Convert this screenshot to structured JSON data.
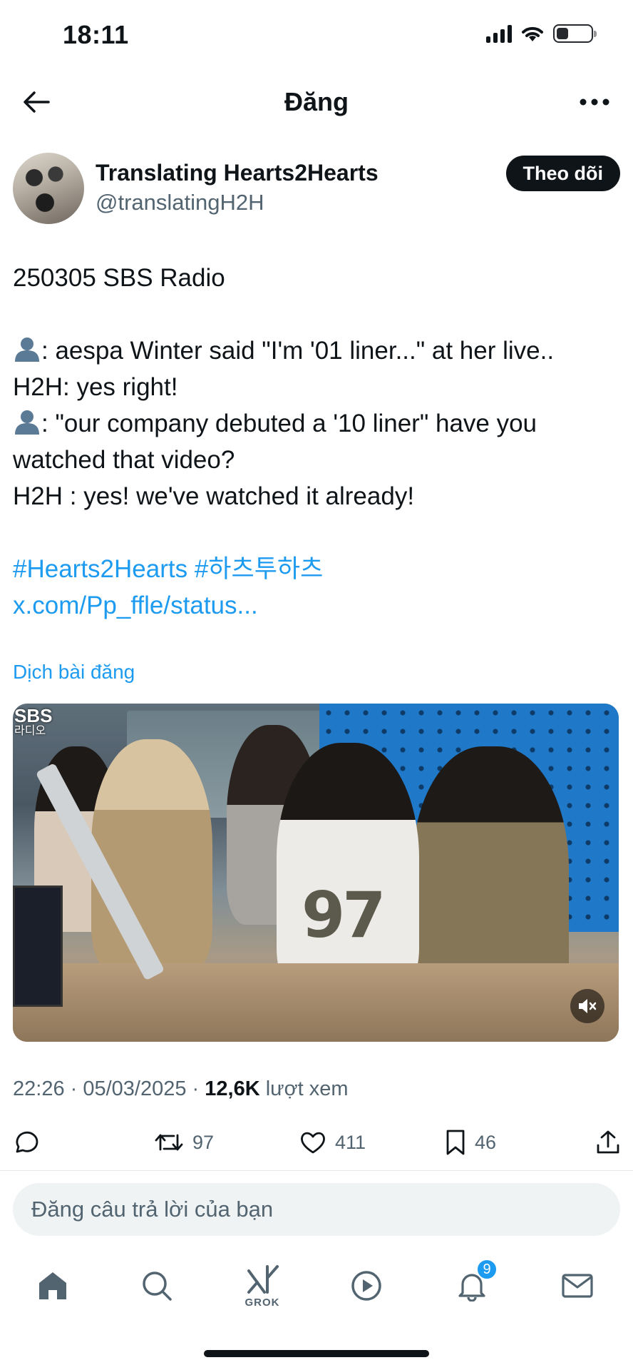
{
  "status_bar": {
    "time": "18:11",
    "battery_level": 0.35
  },
  "header": {
    "title": "Đăng"
  },
  "author": {
    "name": "Translating Hearts2Hearts",
    "handle": "@translatingH2H",
    "follow_label": "Theo dõi"
  },
  "post": {
    "lines": [
      {
        "text": "250305 SBS Radio",
        "icon": ""
      },
      {
        "text": "",
        "icon": ""
      },
      {
        "text": ": aespa Winter said \"I'm '01 liner...\" at her live..",
        "icon": "bust-in-silhouette-icon"
      },
      {
        "text": "H2H: yes right!",
        "icon": ""
      },
      {
        "text": ": \"our company debuted a '10 liner\" have you",
        "icon": "bust-in-silhouette-icon"
      },
      {
        "text": "watched that video?",
        "icon": ""
      },
      {
        "text": "H2H : yes! we've watched it already!",
        "icon": ""
      },
      {
        "text": "",
        "icon": ""
      },
      {
        "text": "#Hearts2Hearts #하츠투하츠",
        "icon": "",
        "link": true
      },
      {
        "text": "x.com/Pp_ffle/status...",
        "icon": "",
        "link": true
      }
    ],
    "translate_label": "Dịch bài đăng"
  },
  "media": {
    "logo_text": "SBS",
    "logo_sub": "라디오",
    "jersey_number": "97"
  },
  "meta": {
    "timestamp": "22:26 · 05/03/2025 · ",
    "views_count": "12,6K",
    "views_label": " lượt xem"
  },
  "actions": {
    "retweets": "97",
    "likes": "411",
    "bookmarks": "46"
  },
  "reply": {
    "placeholder": "Đăng câu trả lời của bạn"
  },
  "nav": {
    "grok_label": "GROK",
    "notification_badge": "9"
  },
  "colors": {
    "accent": "#1d9bf0",
    "text_primary": "#0f1419",
    "text_secondary": "#536471"
  }
}
